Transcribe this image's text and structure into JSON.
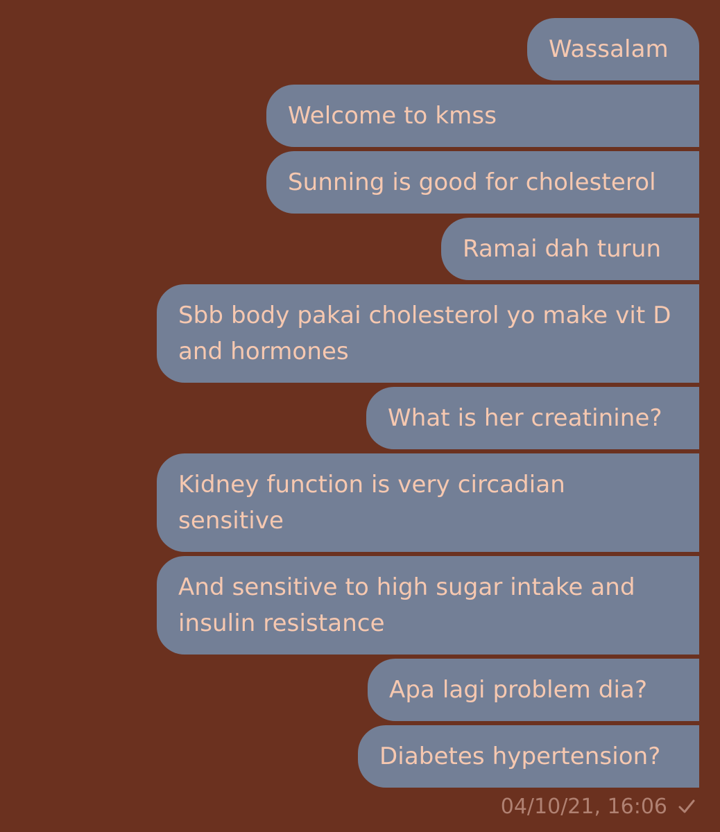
{
  "chat": {
    "messages": [
      {
        "text": "Wassalam"
      },
      {
        "text": "Welcome to kmss"
      },
      {
        "text": "Sunning is good for cholesterol"
      },
      {
        "text": "Ramai dah turun"
      },
      {
        "text": "Sbb body pakai cholesterol yo make vit D and hormones"
      },
      {
        "text": "What is her creatinine?"
      },
      {
        "text": "Kidney function is very circadian sensitive"
      },
      {
        "text": "And sensitive to high sugar intake and insulin resistance"
      },
      {
        "text": "Apa lagi problem dia?"
      },
      {
        "text": "Diabetes hypertension?"
      }
    ],
    "timestamp": "04/10/21, 16:06",
    "status_icon": "check-icon"
  },
  "colors": {
    "background": "#6b311f",
    "bubble": "#737f96",
    "bubble_text": "#f6c8b0",
    "timestamp_text": "#b08172"
  }
}
